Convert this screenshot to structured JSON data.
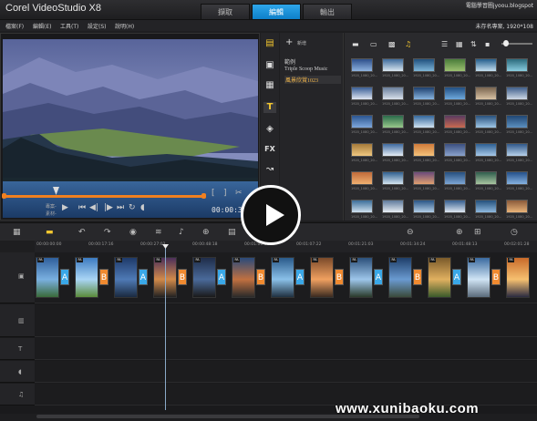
{
  "app": {
    "title": "Corel VideoStudio X8",
    "watermark_top": "電腦學習圖jyoou.blogspot"
  },
  "tabs": [
    {
      "label": "擷取"
    },
    {
      "label": "編輯"
    },
    {
      "label": "輸出"
    }
  ],
  "menu": {
    "items": [
      "檔案(F)",
      "編輯(E)",
      "工具(T)",
      "設定(S)",
      "說明(H)"
    ],
    "project_info": "未存名專案, 1920*108"
  },
  "preview": {
    "timecode": "00:00:34",
    "label_project": "專案-",
    "label_clip": "素材-"
  },
  "library": {
    "add_label": "新增",
    "folders": [
      {
        "label": "範例"
      },
      {
        "label": "Triple Scoop Music"
      },
      {
        "label": "風景欣賞1023"
      }
    ],
    "thumb_caption": "1920_1080_20..."
  },
  "timeline": {
    "ruler": [
      "00:00:00:00",
      "00:00:17:16",
      "00:00:27:02",
      "00:00:48:18",
      "00:01:00:00",
      "00:01:07:22",
      "00:01:21:03",
      "00:01:34:24",
      "00:01:48:13",
      "00:02:01:28"
    ],
    "transition_glyphs": {
      "a": "A",
      "b": "B"
    },
    "fa_label": "FA"
  },
  "overlay": {
    "site_watermark": "www.xunibaoku.com"
  },
  "colors": {
    "accent_tab": "#1a8fdb",
    "scrub": "#f08020",
    "selected_folder": "#f3b74b"
  }
}
